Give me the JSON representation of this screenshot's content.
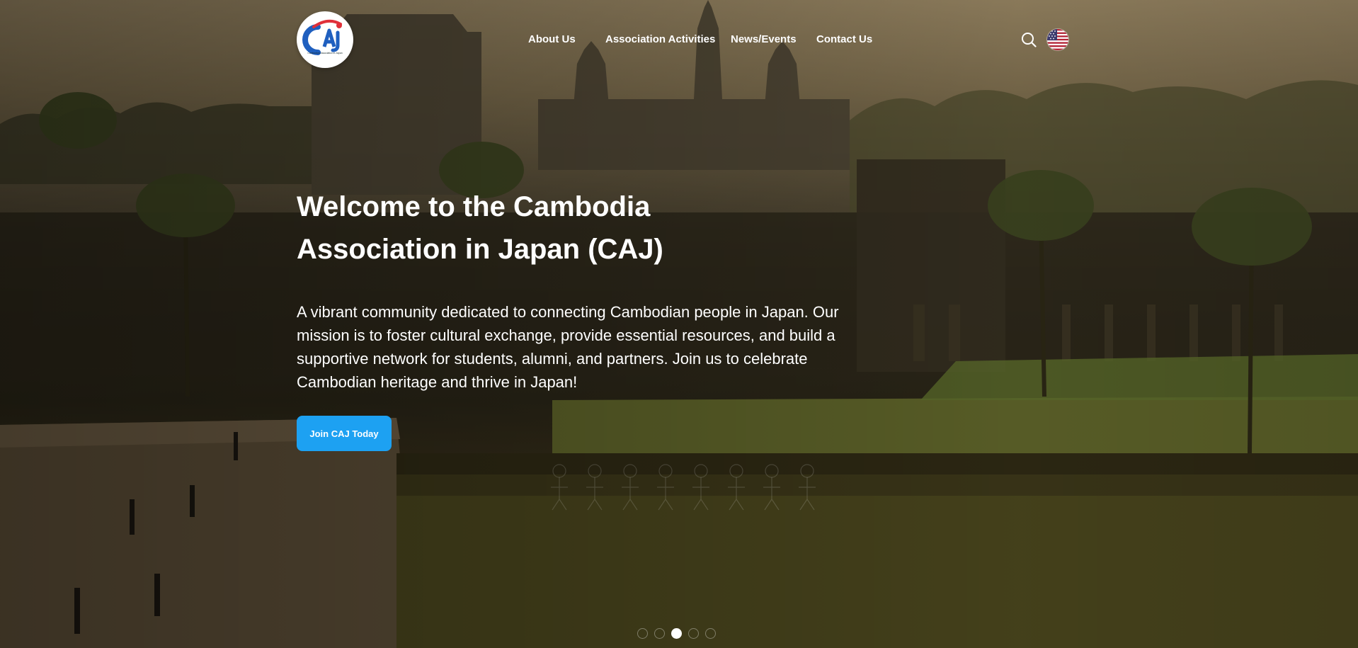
{
  "header": {
    "logo_text": "CAJ",
    "logo_caption": "Cambodian Association in Japan",
    "nav": [
      {
        "label": "About Us"
      },
      {
        "label": "Association Activities"
      },
      {
        "label": "News/Events"
      },
      {
        "label": "Contact Us"
      }
    ],
    "search_icon": "search-icon",
    "language_icon": "us-flag-icon"
  },
  "hero": {
    "title_line1": "Welcome to the Cambodia",
    "title_line2": "Association in Japan (CAJ)",
    "description": "A vibrant community dedicated to connecting Cambodian people in Japan. Our mission is to foster cultural exchange, provide essential resources, and build a supportive network for students, alumni, and partners. Join us to celebrate Cambodian heritage and thrive in Japan!",
    "cta_label": "Join CAJ Today",
    "background": "Angkor Wat temple at sunrise with reflecting pool"
  },
  "carousel": {
    "slide_count": 5,
    "active_index": 2
  },
  "colors": {
    "accent": "#1da1f2",
    "logo_blue": "#1f5fbf",
    "logo_red": "#e0303a"
  }
}
